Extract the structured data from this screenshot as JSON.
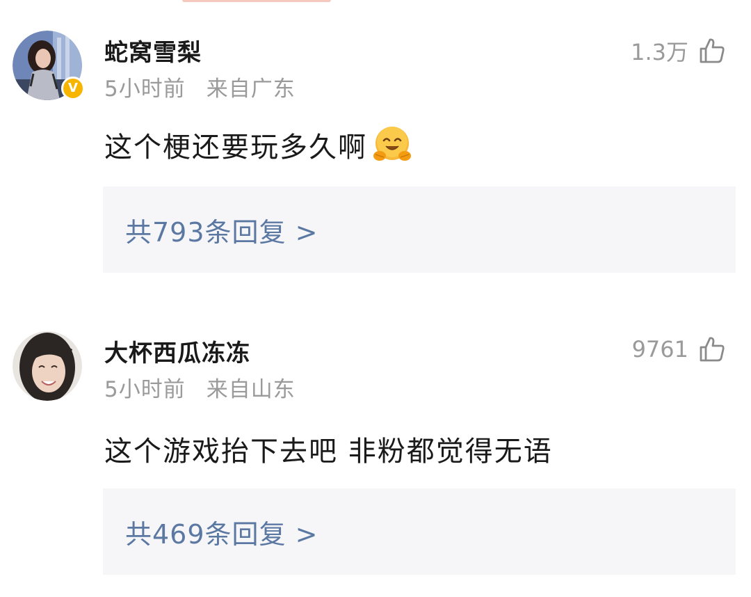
{
  "comments": [
    {
      "username": "蛇窝雪梨",
      "time": "5小时前",
      "location": "来自广东",
      "likes": "1.3万",
      "text": "这个梗还要玩多久啊",
      "emoji": "hugging-face-emoji",
      "verified_badge": "V",
      "replies_label": "共793条回复 >"
    },
    {
      "username": "大杯西瓜冻冻",
      "time": "5小时前",
      "location": "来自山东",
      "likes": "9761",
      "text": "这个游戏抬下去吧 非粉都觉得无语",
      "replies_label": "共469条回复 >"
    }
  ],
  "colors": {
    "reply_link": "#5b78a3",
    "reply_box_bg": "#f6f6f8",
    "meta_text": "#9a9a9a",
    "badge": "#f7b500"
  },
  "icons": {
    "like": "thumbs-up-outline-icon"
  }
}
